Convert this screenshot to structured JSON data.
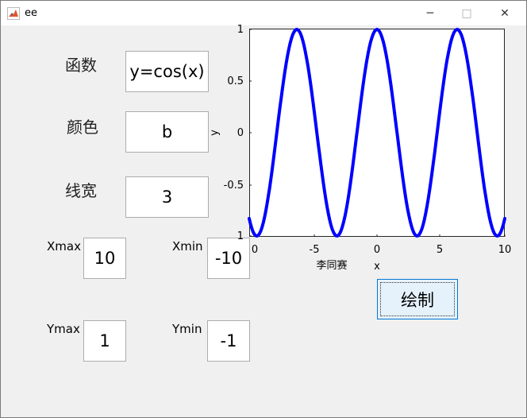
{
  "window": {
    "title": "ee",
    "minimize_glyph": "─",
    "maximize_glyph": "□",
    "close_glyph": "✕"
  },
  "form": {
    "function_label": "函数",
    "function_value": "y=cos(x)",
    "color_label": "颜色",
    "color_value": "b",
    "linewidth_label": "线宽",
    "linewidth_value": "3",
    "xmax_label": "Xmax",
    "xmax_value": "10",
    "xmin_label": "Xmin",
    "xmin_value": "-10",
    "ymax_label": "Ymax",
    "ymax_value": "1",
    "ymin_label": "Ymin",
    "ymin_value": "-1"
  },
  "draw_button_label": "绘制",
  "chart_data": {
    "type": "line",
    "function": "cos",
    "xlim": [
      -1,
      10
    ],
    "ylim": [
      -1,
      1
    ],
    "x_ticks": [
      "0",
      "-5",
      "0",
      "5",
      "10"
    ],
    "y_ticks": [
      "1",
      "0.5",
      "0",
      "-0.5",
      "1"
    ],
    "xlabel": "x",
    "ylabel": "y",
    "annotation": "李同赛",
    "line_color": "#0000ff",
    "grid": false,
    "series": [
      {
        "x": [
          -1.0,
          -0.5,
          0.0,
          0.5,
          1.0,
          1.5,
          2.0,
          2.5,
          3.0,
          3.5,
          4.0,
          4.5,
          5.0,
          5.5,
          6.0,
          6.5,
          7.0,
          7.5,
          8.0,
          8.5,
          9.0,
          9.5,
          10.0
        ],
        "y": [
          0.54,
          0.88,
          1.0,
          0.88,
          0.54,
          0.07,
          -0.42,
          -0.8,
          -0.99,
          -0.94,
          -0.65,
          -0.21,
          0.28,
          0.71,
          0.96,
          0.98,
          0.75,
          0.35,
          -0.15,
          -0.6,
          -0.91,
          -1.0,
          -0.84
        ]
      }
    ]
  }
}
